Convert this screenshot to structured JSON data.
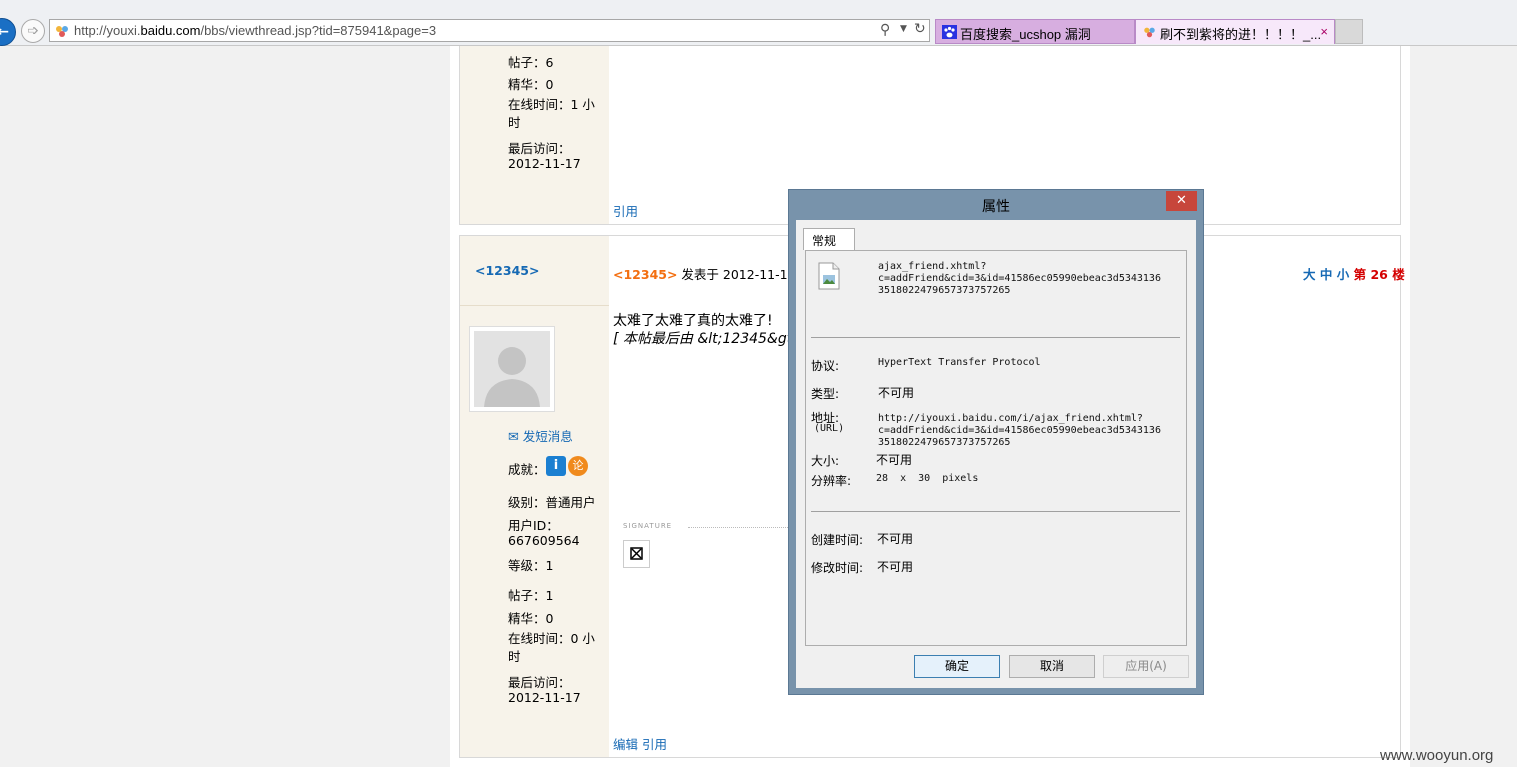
{
  "browser": {
    "url": "http://youxi.baidu.com/bbs/viewthread.jsp?tid=875941&page=3",
    "url_prefix": "http://youxi.",
    "url_domain": "baidu.com",
    "url_suffix": "/bbs/viewthread.jsp?tid=875941&page=3",
    "tabs": [
      {
        "label": "百度搜索_ucshop 漏洞",
        "active": false
      },
      {
        "label": "刷不到紫将的进！！！！_...",
        "active": true
      }
    ],
    "tab_close": "×"
  },
  "post1": {
    "stats": [
      {
        "label": "帖子：6"
      },
      {
        "label": "精华：0"
      },
      {
        "label": "在线时间：1 小时"
      },
      {
        "label": "最后访问："
      },
      {
        "label": "2012-11-17"
      }
    ],
    "quote_link": "引用"
  },
  "post2": {
    "username": "<12345>",
    "author": "<12345>",
    "posted_at": "发表于 2012-11-17 1",
    "size_large": "大",
    "size_medium": "中",
    "size_small": "小",
    "floor": "第 26 楼",
    "body": "太难了太难了真的太难了!",
    "edit_note": "[ 本帖最后由 &lt;12345&gt;",
    "send_msg": "发短消息",
    "achievement_label": "成就：",
    "level_label": "级别：普通用户",
    "uid_label": "用户ID：",
    "uid_value": "667609564",
    "grade_label": "等级：1",
    "posts": "帖子：1",
    "digest": "精华：0",
    "online": "在线时间：0 小时",
    "last_visit_label": "最后访问：",
    "last_visit": "2012-11-17",
    "signature_label": "SIGNATURE",
    "edit_link": "编辑",
    "quote_link": "引用"
  },
  "dialog": {
    "title": "属性",
    "close": "✕",
    "tab": "常规",
    "file_name_line1": "ajax_friend.xhtml?",
    "file_name_line2": "c=addFriend&cid=3&id=41586ec05990ebeac3d5343136",
    "file_name_line3": "3518022479657373757265",
    "protocol_label": "协议:",
    "protocol_value": "HyperText Transfer Protocol",
    "type_label": "类型:",
    "type_value": "不可用",
    "address_label": "地址:",
    "address_sub": "(URL)",
    "address_line1": "http://iyouxi.baidu.com/i/ajax_friend.xhtml?",
    "address_line2": "c=addFriend&cid=3&id=41586ec05990ebeac3d5343136",
    "address_line3": "3518022479657373757265",
    "size_label": "大小:",
    "size_value": "不可用",
    "resolution_label": "分辨率:",
    "resolution_value": "28  x  30  pixels",
    "created_label": "创建时间:",
    "created_value": "不可用",
    "modified_label": "修改时间:",
    "modified_value": "不可用",
    "ok": "确定",
    "cancel": "取消",
    "apply": "应用(A)"
  },
  "watermark": "www.wooyun.org",
  "colors": {
    "link_blue": "#1669b4",
    "author_orange": "#f36f11",
    "floor_red": "#d40000",
    "sidebar_bg": "#f7f3ea",
    "dialog_frame": "#7893ab",
    "close_red": "#c7463b"
  }
}
